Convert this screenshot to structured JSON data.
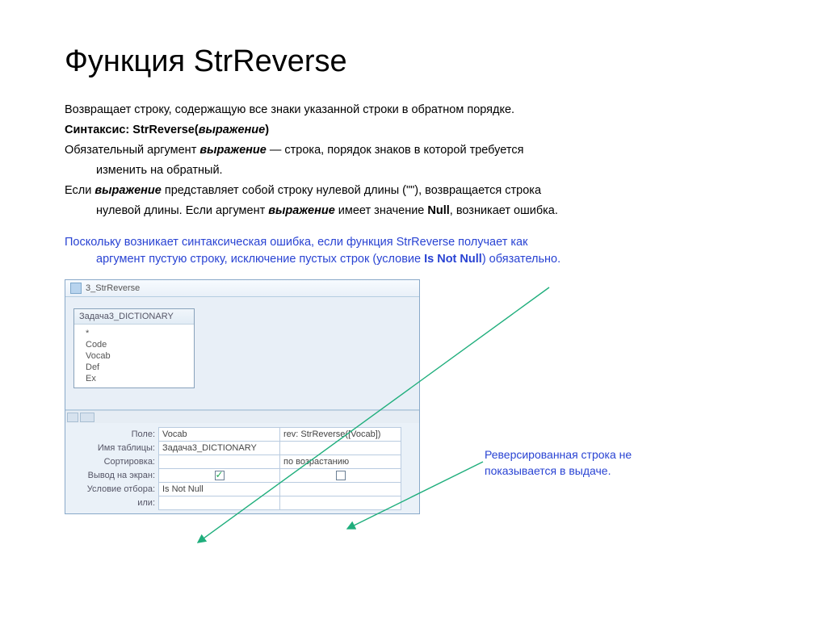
{
  "title": "Функция StrReverse",
  "p1": "Возвращает строку, содержащую все знаки указанной строки в обратном порядке.",
  "syntax_label": "Синтаксис: ",
  "syntax_fn": "StrReverse(",
  "syntax_arg": "выражение",
  "syntax_close": ")",
  "p2a": "Обязательный аргумент ",
  "p2arg": "выражение",
  "p2b": " — строка, порядок знаков в которой требуется",
  "p2c": "изменить на обратный.",
  "p3a": "Если ",
  "p3arg": "выражение",
  "p3b": " представляет собой строку нулевой длины (\"\"), возвращается строка",
  "p3c": "нулевой длины. Если аргумент ",
  "p3arg2": "выражение",
  "p3d": " имеет значение ",
  "p3null": "Null",
  "p3e": ", возникает ошибка.",
  "note_a": "Поскольку возникает синтаксическая ошибка, если функция StrReverse получает как",
  "note_b": "аргумент пустую строку, исключение пустых строк (условие ",
  "note_cond": "Is Not Null",
  "note_c": ") обязательно.",
  "shot": {
    "win_title": "3_StrReverse",
    "table_name": "Задача3_DICTIONARY",
    "fields": [
      "*",
      "Code",
      "Vocab",
      "Def",
      "Ex"
    ],
    "rows": {
      "field_label": "Поле:",
      "table_label": "Имя таблицы:",
      "sort_label": "Сортировка:",
      "show_label": "Вывод на экран:",
      "criteria_label": "Условие отбора:",
      "or_label": "или:",
      "c1_field": "Vocab",
      "c2_field": "rev: StrReverse([Vocab])",
      "c1_table": "Задача3_DICTIONARY",
      "c2_sort": "по возрастанию",
      "c1_criteria": "Is Not Null"
    }
  },
  "annotation": "Реверсированная строка не показывается в выдаче."
}
